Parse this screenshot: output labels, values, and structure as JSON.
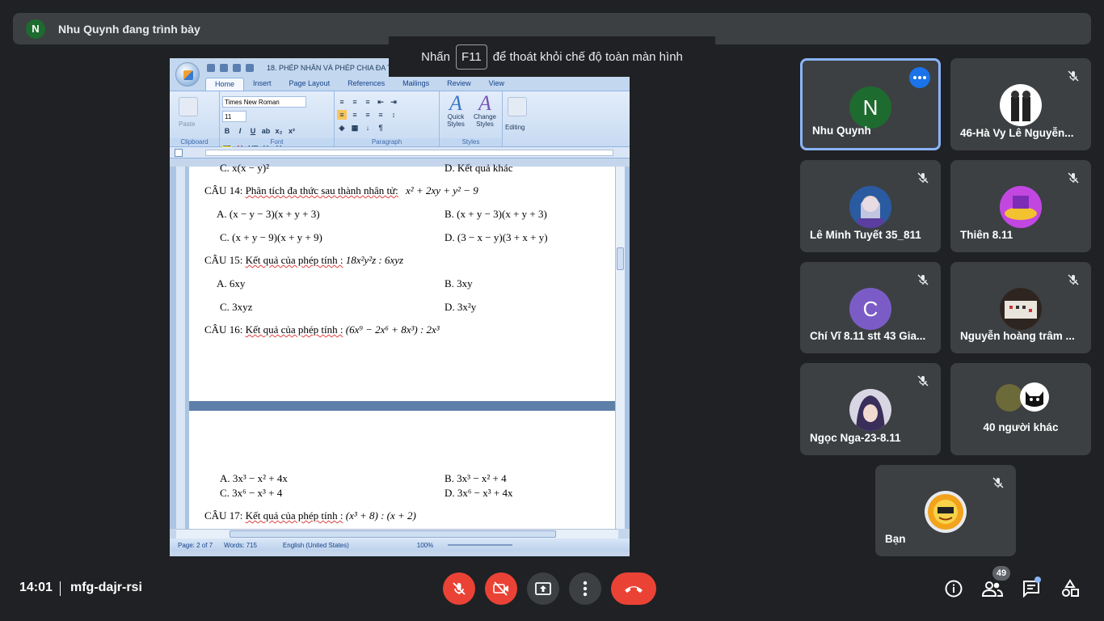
{
  "presenter": {
    "initial": "N",
    "text": "Nhu Quynh đang trình bày"
  },
  "fullscreen_tip": {
    "before": "Nhấn",
    "key": "F11",
    "after": "để thoát khỏi chế độ toàn màn hình"
  },
  "word": {
    "title": "18. PHÉP NHÂN VÀ PHÉP CHIA ĐA THỨC",
    "tabs": [
      "Home",
      "Insert",
      "Page Layout",
      "References",
      "Mailings",
      "Review",
      "View"
    ],
    "font_name": "Times New Roman",
    "font_size": "11",
    "groups": {
      "clipboard": "Clipboard",
      "font": "Font",
      "paragraph": "Paragraph",
      "styles": "Styles",
      "editing": "Editing"
    },
    "paste_label": "Paste",
    "quick_styles": "Quick Styles",
    "change_styles": "Change Styles",
    "page1": {
      "q13c": "C. x(x − y)²",
      "q13d": "D. Kết quả khác",
      "q14_label": "CÂU 14:",
      "q14_text": "Phân tích đa thức sau thành nhân tử:",
      "q14_expr": "x² + 2xy + y² − 9",
      "q14a": "A. (x − y − 3)(x + y + 3)",
      "q14b": "B. (x + y − 3)(x + y + 3)",
      "q14c": "C. (x + y − 9)(x + y + 9)",
      "q14d": "D. (3 − x − y)(3 + x + y)",
      "q15_label": "CÂU 15:",
      "q15_text": "Kết quả của phép tính :",
      "q15_expr": "18x²y²z : 6xyz",
      "q15a": "A. 6xy",
      "q15b": "B. 3xy",
      "q15c": "C. 3xyz",
      "q15d": "D. 3x²y",
      "q16_label": "CÂU 16:",
      "q16_text": "Kết quả của phép tính :",
      "q16_expr": "(6x⁹ − 2x⁶ + 8x³) : 2x³"
    },
    "page2": {
      "q16a": "A. 3x³ − x² + 4x",
      "q16b": "B. 3x³ − x² + 4",
      "q16c": "C. 3x⁶ − x³ + 4",
      "q16d": "D. 3x⁶ − x³ + 4x",
      "q17_label": "CÂU 17:",
      "q17_text": "Kết quả của phép tính :",
      "q17_expr": "(x³ + 8) : (x + 2)"
    },
    "status": {
      "page": "Page: 2 of 7",
      "words": "Words: 715",
      "language": "English (United States)",
      "zoom": "100%"
    }
  },
  "participants": [
    {
      "name": "Nhu Quynh",
      "initial": "N",
      "color": "#1e6b2f"
    },
    {
      "name": "46-Hà Vy Lê Nguyễn...",
      "initial": "",
      "color": "#ffffff"
    },
    {
      "name": "Lê Minh Tuyết 35_811",
      "initial": "",
      "color": "#3a6fb5"
    },
    {
      "name": "Thiên 8.11",
      "initial": "",
      "color": "#b43cd6"
    },
    {
      "name": "Chí Vĩ 8.11 stt 43 Gia...",
      "initial": "C",
      "color": "#7b5cc7"
    },
    {
      "name": "Nguyễn hoàng trâm ...",
      "initial": "",
      "color": "#5a4a42"
    },
    {
      "name": "Ngọc Nga-23-8.11",
      "initial": "",
      "color": "#4a4060"
    },
    {
      "name": "Bạn",
      "initial": "",
      "color": "#e8a31a"
    }
  ],
  "others": {
    "label": "40 người khác"
  },
  "bottom": {
    "time": "14:01",
    "meeting_code": "mfg-dajr-rsi",
    "people_count": "49"
  },
  "colors": {
    "accent": "#8ab4f8",
    "danger": "#ea4335",
    "tile": "#3c4043",
    "bg": "#202124"
  }
}
